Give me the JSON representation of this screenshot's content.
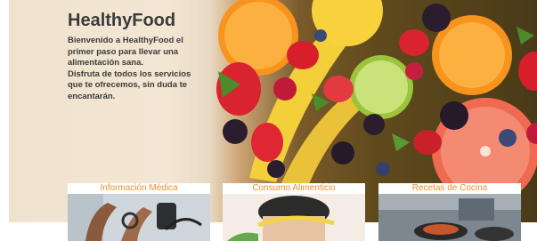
{
  "brand": {
    "title": "HealthyFood"
  },
  "intro": {
    "lines": [
      "Bienvenido a HealthyFood el",
      "primer paso para llevar una",
      "alimentación sana.",
      "Disfruta de todos los servicios",
      "que te ofrecemos, sin duda te",
      "encantarán."
    ]
  },
  "cards": [
    {
      "title": "Información Médica"
    },
    {
      "title": "Consumo Alimenticio"
    },
    {
      "title": "Recetas de Cocina"
    }
  ],
  "colors": {
    "accent": "#f28c28",
    "text": "#3b3b3b",
    "background": "#ffffff"
  }
}
